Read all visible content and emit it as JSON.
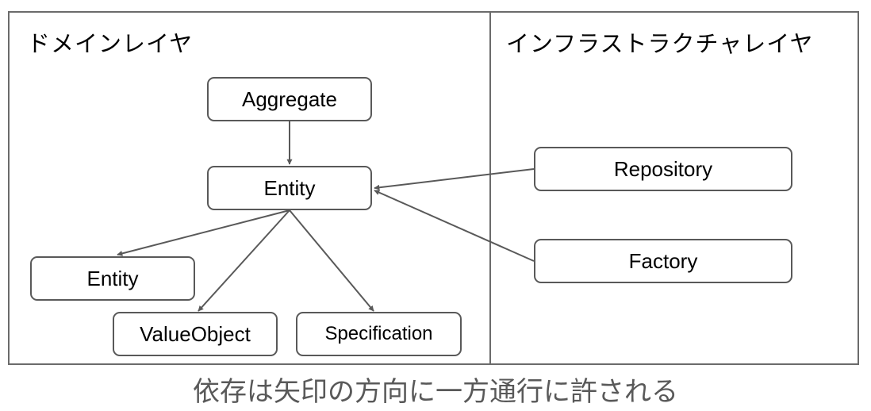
{
  "layers": {
    "domain": {
      "title": "ドメインレイヤ"
    },
    "infrastructure": {
      "title": "インフラストラクチャレイヤ"
    }
  },
  "nodes": {
    "aggregate": {
      "label": "Aggregate"
    },
    "entity_main": {
      "label": "Entity"
    },
    "entity_child": {
      "label": "Entity"
    },
    "value_object": {
      "label": "ValueObject"
    },
    "specification": {
      "label": "Specification"
    },
    "repository": {
      "label": "Repository"
    },
    "factory": {
      "label": "Factory"
    }
  },
  "edges": [
    {
      "from": "aggregate",
      "to": "entity_main"
    },
    {
      "from": "entity_main",
      "to": "entity_child"
    },
    {
      "from": "entity_main",
      "to": "value_object"
    },
    {
      "from": "entity_main",
      "to": "specification"
    },
    {
      "from": "repository",
      "to": "entity_main"
    },
    {
      "from": "factory",
      "to": "entity_main"
    }
  ],
  "caption": "依存は矢印の方向に一方通行に許される",
  "colors": {
    "stroke": "#595959",
    "caption": "#595959",
    "text": "#000000"
  }
}
